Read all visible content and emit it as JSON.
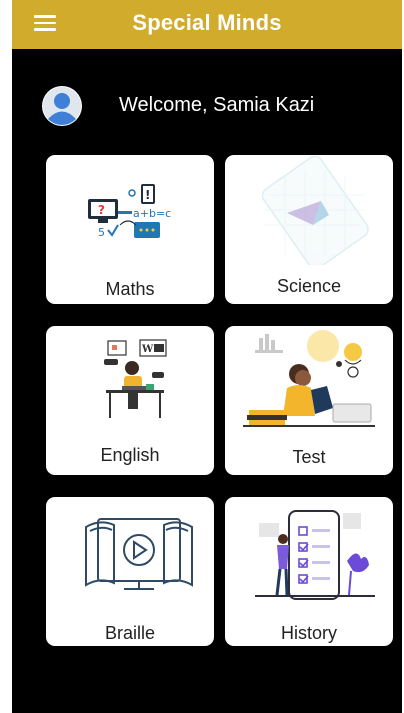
{
  "app": {
    "title": "Special Minds",
    "bar_color": "#d1ab2c",
    "menu_icon": "menu-icon"
  },
  "user": {
    "welcome": "Welcome, Samia Kazi",
    "avatar_icon": "user-avatar-icon"
  },
  "subjects": [
    {
      "label": "Maths",
      "icon": "maths-illustration"
    },
    {
      "label": "Science",
      "icon": "science-illustration"
    },
    {
      "label": "English",
      "icon": "english-illustration"
    },
    {
      "label": "Test",
      "icon": "test-illustration"
    },
    {
      "label": "Braille",
      "icon": "braille-illustration"
    },
    {
      "label": "History",
      "icon": "history-illustration"
    }
  ],
  "maths_art": {
    "symbols": [
      "?",
      "!",
      "a+b=c",
      "5"
    ]
  }
}
